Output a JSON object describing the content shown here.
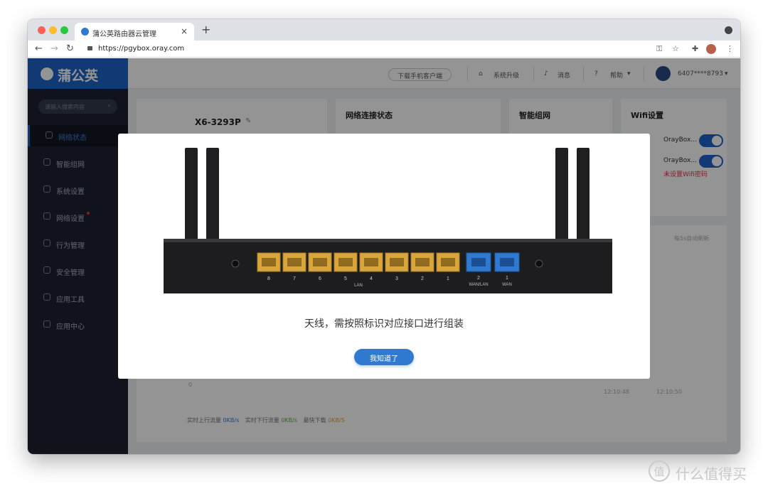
{
  "browser": {
    "tab_title": "蒲公英路由器云管理",
    "url": "https://pgybox.oray.com",
    "new_tab": "+",
    "tab_close": "×"
  },
  "sidebar": {
    "logo": "蒲公英",
    "search_placeholder": "请输入搜索内容",
    "items": [
      {
        "label": "网络状态",
        "icon": "status-icon",
        "active": true
      },
      {
        "label": "智能组网",
        "icon": "network-icon"
      },
      {
        "label": "系统设置",
        "icon": "gear-icon"
      },
      {
        "label": "网络设置",
        "icon": "network-settings-icon",
        "dot": true
      },
      {
        "label": "行为管理",
        "icon": "behavior-icon"
      },
      {
        "label": "安全管理",
        "icon": "shield-icon"
      },
      {
        "label": "应用工具",
        "icon": "toolbox-icon"
      },
      {
        "label": "应用中心",
        "icon": "app-center-icon"
      }
    ]
  },
  "topbar": {
    "download_app": "下载手机客户端",
    "upgrade": "系统升级",
    "messages": "消息",
    "help": "帮助",
    "account": "6407****8793"
  },
  "dashboard": {
    "device_name": "X6-3293P",
    "network_status_title": "网络连接状态",
    "mesh_title": "智能组网",
    "wifi_title": "Wifi设置",
    "wifi_1": "OrayBox...",
    "wifi_2": "OrayBox...",
    "wifi_warning": "未设置Wifi密码",
    "refresh_note": "每5s自动刷新",
    "y_zero": "0",
    "time_1": "12:10:48",
    "time_2": "12:10:50",
    "legend_up": "实时上行流量",
    "legend_up_val": "0KB/s",
    "legend_down": "实时下行流量",
    "legend_down_val": "0KB/s",
    "legend_peak": "最快下载",
    "legend_peak_val": "0KB/S"
  },
  "modal": {
    "lan_ports": [
      "8",
      "7",
      "6",
      "5",
      "4",
      "3",
      "2",
      "1"
    ],
    "lan_label": "LAN",
    "wan_ports": [
      {
        "num": "2",
        "label": "WAN/LAN"
      },
      {
        "num": "1",
        "label": "WAN"
      }
    ],
    "message": "天线，需按照标识对应接口进行组装",
    "ok_button": "我知道了"
  },
  "watermark": "什么值得买",
  "colors": {
    "brand_blue": "#1e64c8",
    "sidebar_bg": "#1c2230",
    "lan_port": "#d8a63a",
    "wan_port": "#2f79d0",
    "warning_red": "#e0383e"
  }
}
